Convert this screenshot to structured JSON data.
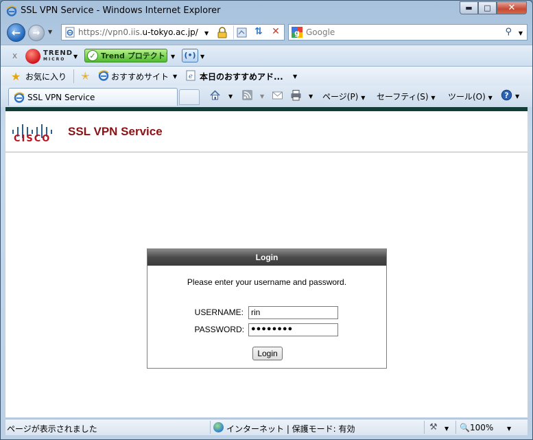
{
  "window": {
    "title": "SSL VPN Service - Windows Internet Explorer",
    "min_glyph": "▬",
    "max_glyph": "□",
    "close_glyph": "✕"
  },
  "address_bar": {
    "url_prefix": "https://vpn0.iis.",
    "url_domain": "u-tokyo.ac.jp/",
    "search_placeholder": "Google"
  },
  "trend_toolbar": {
    "close": "x",
    "brand_top": "TREND",
    "brand_bottom": "MICRO",
    "protect_label": "Trend プロテクト™"
  },
  "favorites_bar": {
    "favorites": "お気に入り",
    "recommended_sites": "おすすめサイト",
    "today": "本日のおすすめアド..."
  },
  "tabs": [
    {
      "label": "SSL VPN Service"
    }
  ],
  "command_bar": {
    "page": "ページ(P)",
    "safety": "セーフティ(S)",
    "tools": "ツール(O)"
  },
  "page": {
    "brand": "CISCO",
    "title": "SSL VPN Service",
    "login": {
      "header": "Login",
      "message": "Please enter your username and password.",
      "username_label": "USERNAME:",
      "username_value": "rin",
      "password_label": "PASSWORD:",
      "password_value": "●●●●●●●●",
      "button": "Login"
    }
  },
  "status_bar": {
    "status": "ページが表示されました",
    "zone": "インターネット | 保護モード: 有効",
    "zoom": "100%"
  },
  "colors": {
    "cisco_red": "#b8111d",
    "title_red": "#8a1215",
    "header_band": "#123c37"
  }
}
